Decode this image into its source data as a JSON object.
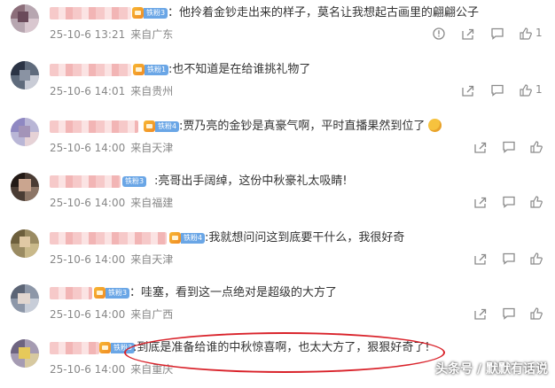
{
  "comments": [
    {
      "fan_badge": "铁粉3",
      "text": "：他拎着金钞走出来的样子，莫名让我想起古画里的翩翩公子",
      "date": "25-10-6 13:21",
      "location": "来自广东",
      "likes": "1"
    },
    {
      "fan_badge": "铁粉1",
      "text": ":也不知道是在给谁挑礼物了",
      "date": "25-10-6 14:01",
      "location": "来自贵州",
      "likes": "1"
    },
    {
      "fan_badge": "铁粉4",
      "text": ":贾乃亮的金钞是真豪气啊，平时直播果然到位了",
      "date": "25-10-6 14:00",
      "location": "来自天津",
      "likes": ""
    },
    {
      "fan_badge": "铁粉3",
      "text": ":亮哥出手阔绰，这份中秋豪礼太吸睛!",
      "date": "25-10-6 14:00",
      "location": "来自福建",
      "likes": ""
    },
    {
      "fan_badge": "铁粉4",
      "text": ":我就想问问这到底要干什么，我很好奇",
      "date": "25-10-6 14:00",
      "location": "来自天津",
      "likes": ""
    },
    {
      "fan_badge": "铁粉3",
      "text": "：哇塞，看到这一点绝对是超级的大方了",
      "date": "25-10-6 14:00",
      "location": "来自广西",
      "likes": ""
    },
    {
      "fan_badge": "铁粉3",
      "text": ":到底是准备给谁的中秋惊喜啊，也太大方了，狠狠好奇了!",
      "date": "25-10-6 14:00",
      "location": "来自重庆",
      "likes": ""
    }
  ],
  "watermark": "头条号 / 默默有话说",
  "colors": {
    "badge_blue": "#6aa6e6",
    "badge_gold": "#f7b733",
    "highlight_red": "#d9232b",
    "meta_gray": "#888888"
  },
  "icons": {
    "report": "report-icon",
    "share": "share-icon",
    "comment": "comment-icon",
    "like": "like-icon",
    "emoji": "emoji-icon"
  }
}
